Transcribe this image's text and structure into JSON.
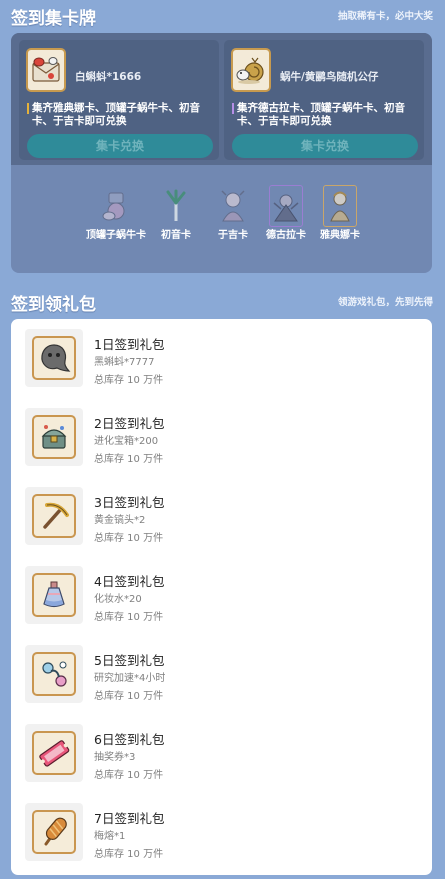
{
  "collect_section": {
    "title": "签到集卡牌",
    "subtitle": "抽取稀有卡，必中大奖",
    "rewards": [
      {
        "icon": "mail-bundle-icon",
        "name": "白蝌蚪*1666",
        "desc": "集齐雅典娜卡、顶罐子蜗牛卡、初音卡、于吉卡即可兑换",
        "bar_color": "#e5b23a",
        "button": "集卡兑换"
      },
      {
        "icon": "snail-doll-icon",
        "name": "蜗牛/黄鹂鸟随机公仔",
        "desc": "集齐德古拉卡、顶罐子蜗牛卡、初音卡、于吉卡即可兑换",
        "bar_color": "#b58ee6",
        "button": "集卡兑换"
      }
    ],
    "cards": [
      {
        "icon": "snail-jar-card-icon",
        "label": "顶罐子蜗牛卡",
        "frame": "plain"
      },
      {
        "icon": "leek-card-icon",
        "label": "初音卡",
        "frame": "plain"
      },
      {
        "icon": "yuji-card-icon",
        "label": "于吉卡",
        "frame": "plain"
      },
      {
        "icon": "dracula-card-icon",
        "label": "德古拉卡",
        "frame": "purple"
      },
      {
        "icon": "athena-card-icon",
        "label": "雅典娜卡",
        "frame": "gold"
      }
    ]
  },
  "gift_section": {
    "title": "签到领礼包",
    "subtitle": "领游戏礼包，先到先得",
    "gifts": [
      {
        "icon": "black-tadpole-icon",
        "title": "1日签到礼包",
        "item": "黑蝌蚪*7777",
        "stock": "总库存 10 万件"
      },
      {
        "icon": "treasure-chest-icon",
        "title": "2日签到礼包",
        "item": "进化宝箱*200",
        "stock": "总库存 10 万件"
      },
      {
        "icon": "pickaxe-icon",
        "title": "3日签到礼包",
        "item": "黄金镐头*2",
        "stock": "总库存 10 万件"
      },
      {
        "icon": "potion-bottle-icon",
        "title": "4日签到礼包",
        "item": "化妆水*20",
        "stock": "总库存 10 万件"
      },
      {
        "icon": "research-speedup-icon",
        "title": "5日签到礼包",
        "item": "研究加速*4小时",
        "stock": "总库存 10 万件"
      },
      {
        "icon": "lottery-ticket-icon",
        "title": "6日签到礼包",
        "item": "抽奖券*3",
        "stock": "总库存 10 万件"
      },
      {
        "icon": "popsicle-icon",
        "title": "7日签到礼包",
        "item": "梅熔*1",
        "stock": "总库存 10 万件"
      }
    ]
  }
}
